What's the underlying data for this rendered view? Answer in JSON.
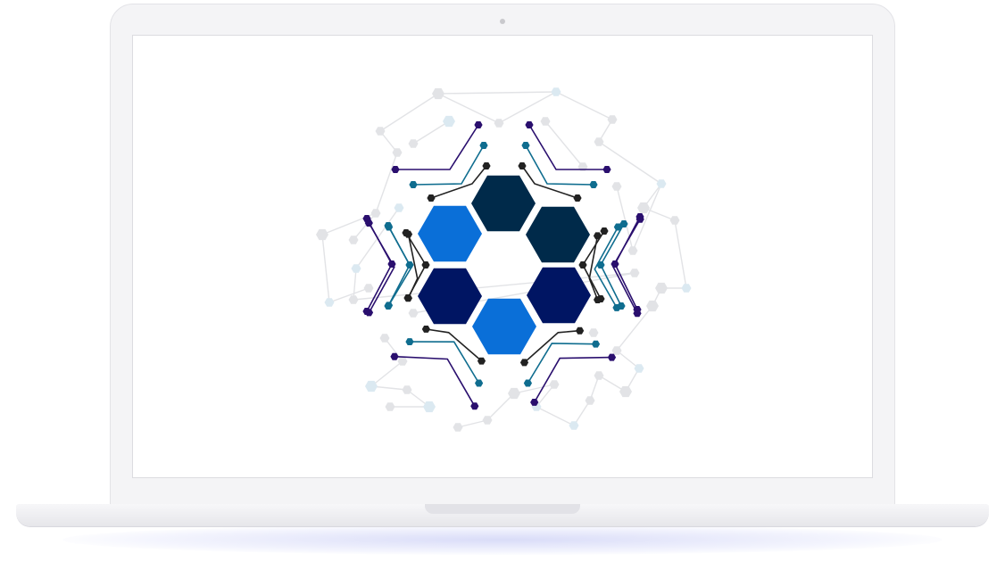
{
  "graphic": {
    "colors": {
      "hex_light_blue": "#0a6fd8",
      "hex_navy": "#002a4a",
      "hex_dark_blue": "#001563",
      "circuit_purple": "#2a0f6e",
      "circuit_teal": "#0f6d8f",
      "circuit_black": "#222222",
      "background_network": "#e2e3e6",
      "background_network_blue": "#dbe9f1"
    }
  }
}
